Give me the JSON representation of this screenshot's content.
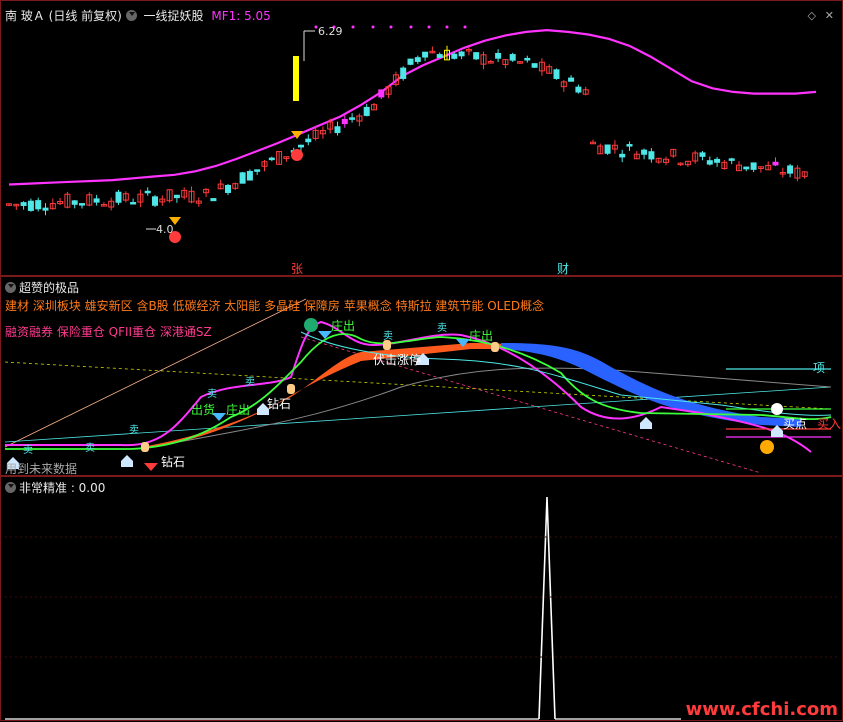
{
  "title": {
    "stock": "南 玻Ａ",
    "period": "(日线 前复权)",
    "indicator": "一线捉妖股",
    "mf_label": "MF1: 5.05"
  },
  "price_labels": {
    "high": "6.29",
    "low": "4.0"
  },
  "event_tags": {
    "zhang": "张",
    "cai": "财"
  },
  "indicator_pane": {
    "title": "超赞的极品",
    "concepts_line1": "建材 深圳板块 雄安新区 含B股 低碳经济 太阳能 多晶硅 保障房 苹果概念 特斯拉 建筑节能 OLED概念",
    "concepts_line2": "融资融券 保险重仓 QFII重仓 深港通SZ",
    "annotations": {
      "zhuang_chu_1": "庄出",
      "zhuang_chu_2": "庄出",
      "zhuang_chu_3": "庄出",
      "chu_huo": "出货",
      "fu_ji_zhang_ting": "伏击涨停",
      "zuan_shi_1": "钻石",
      "zuan_shi_2": "钻石",
      "mai_1": "卖",
      "mai_2": "卖",
      "mai_3": "卖",
      "mai_4": "卖",
      "mai_5": "卖",
      "mai_6": "卖",
      "mai_7": "卖",
      "xiang": "项",
      "mai_dian": "买点",
      "mai_ru": "买入",
      "future_data": "用到未来数据"
    }
  },
  "bottom_pane": {
    "label": "非常精准 : 0.00"
  },
  "watermark": "www.cfchi.com",
  "colors": {
    "up": "#ff3b3b",
    "down": "#4ee6e6",
    "ma": "#ff33ff",
    "orange": "#ff5a1e",
    "blue": "#2a62ff",
    "yellow": "#ffff00"
  },
  "chart_data": {
    "type": "candlestick",
    "series_ma": [
      {
        "name": "MF1",
        "values": [
          4.55,
          4.56,
          4.57,
          4.58,
          4.59,
          4.6,
          4.62,
          4.64,
          4.66,
          4.7,
          4.76,
          4.84,
          4.93,
          5.02,
          5.12,
          5.22,
          5.32,
          5.45,
          5.6,
          5.78,
          5.9,
          6.0,
          6.1,
          6.18,
          6.24,
          6.28,
          6.3,
          6.28,
          6.25,
          6.2,
          6.12,
          6.0,
          5.86,
          5.72,
          5.64,
          5.6,
          5.58,
          5.58,
          5.58,
          5.6
        ]
      }
    ],
    "price_high": 6.29,
    "price_low": 4.0,
    "bottom_value": 0.0
  }
}
